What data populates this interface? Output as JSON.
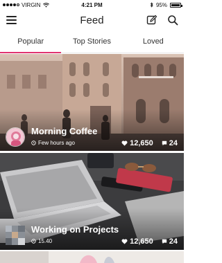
{
  "status_bar": {
    "carrier": "VIRGIN",
    "time": "4:21 PM",
    "battery": "95%",
    "bluetooth_icon": "bluetooth-icon",
    "wifi_icon": "wifi-icon"
  },
  "nav": {
    "title": "Feed",
    "menu_icon": "hamburger-menu-icon",
    "edit_icon": "edit-icon",
    "search_icon": "search-icon"
  },
  "tabs": [
    {
      "label": "Popular",
      "active": true
    },
    {
      "label": "Top Stories",
      "active": false
    },
    {
      "label": "Loved",
      "active": false
    }
  ],
  "accent_color": "#e0336f",
  "cards": [
    {
      "title": "Morning Coffee",
      "time": "Few hours ago",
      "likes": "12,650",
      "comments": "24"
    },
    {
      "title": "Working on Projects",
      "time": "15.40",
      "likes": "12,650",
      "comments": "24"
    }
  ]
}
